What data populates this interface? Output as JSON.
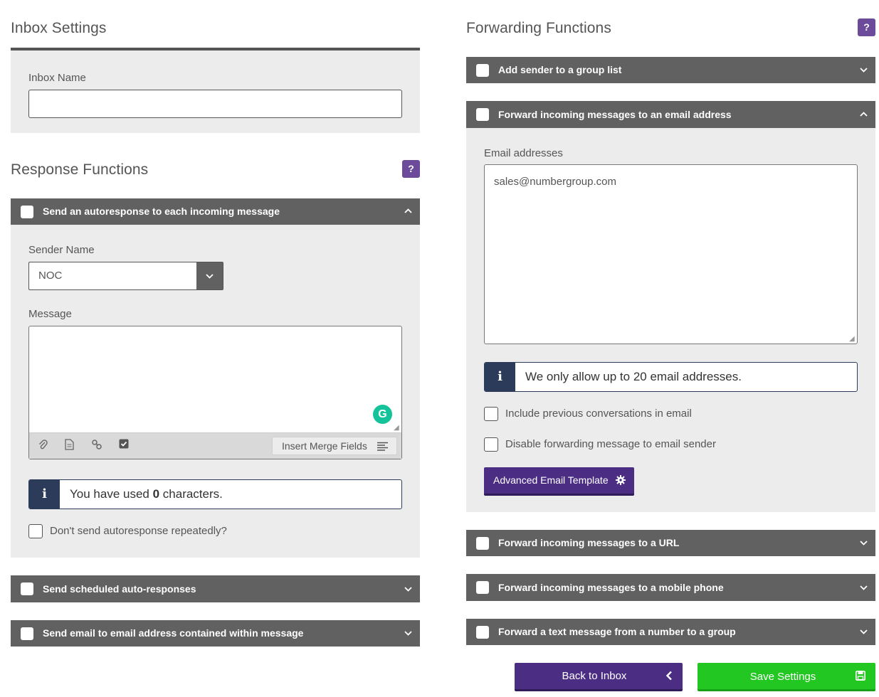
{
  "inbox_settings": {
    "title": "Inbox Settings",
    "inbox_name_label": "Inbox Name",
    "inbox_name_value": ""
  },
  "response_functions": {
    "title": "Response Functions",
    "help": "?",
    "autoresponse": {
      "label": "Send an autoresponse to each incoming message",
      "chevron": "^",
      "sender_name_label": "Sender Name",
      "sender_name_value": "NOC",
      "message_label": "Message",
      "message_value": "",
      "merge_fields_label": "Insert Merge Fields",
      "char_info_prefix": "You have used ",
      "char_count": "0",
      "char_info_suffix": " characters.",
      "dont_repeat_label": "Don't send autoresponse repeatedly?"
    },
    "scheduled": {
      "label": "Send scheduled auto-responses",
      "chevron": "v"
    },
    "email_contained": {
      "label": "Send email to email address contained within message",
      "chevron": "v"
    }
  },
  "forwarding_functions": {
    "title": "Forwarding Functions",
    "help": "?",
    "group_list": {
      "label": "Add sender to a group list",
      "chevron": "v"
    },
    "email_forward": {
      "label": "Forward incoming messages to an email address",
      "chevron": "^",
      "email_label": "Email addresses",
      "email_value": "sales@numbergroup.com",
      "info_text": "We only allow up to 20 email addresses.",
      "include_prev_label": "Include previous conversations in email",
      "disable_forward_label": "Disable forwarding message to email sender",
      "advanced_template_label": "Advanced Email Template"
    },
    "url_forward": {
      "label": "Forward incoming messages to a URL",
      "chevron": "v"
    },
    "mobile_forward": {
      "label": "Forward incoming messages to a mobile phone",
      "chevron": "v"
    },
    "text_group_forward": {
      "label": "Forward a text message from a number to a group",
      "chevron": "v"
    }
  },
  "actions": {
    "back_label": "Back to Inbox",
    "save_label": "Save Settings"
  },
  "colors": {
    "panel_header": "#616161",
    "purple": "#6b4b9a",
    "navy": "#2d3b5a",
    "green": "#22c722",
    "back_button": "#4b2d84"
  }
}
